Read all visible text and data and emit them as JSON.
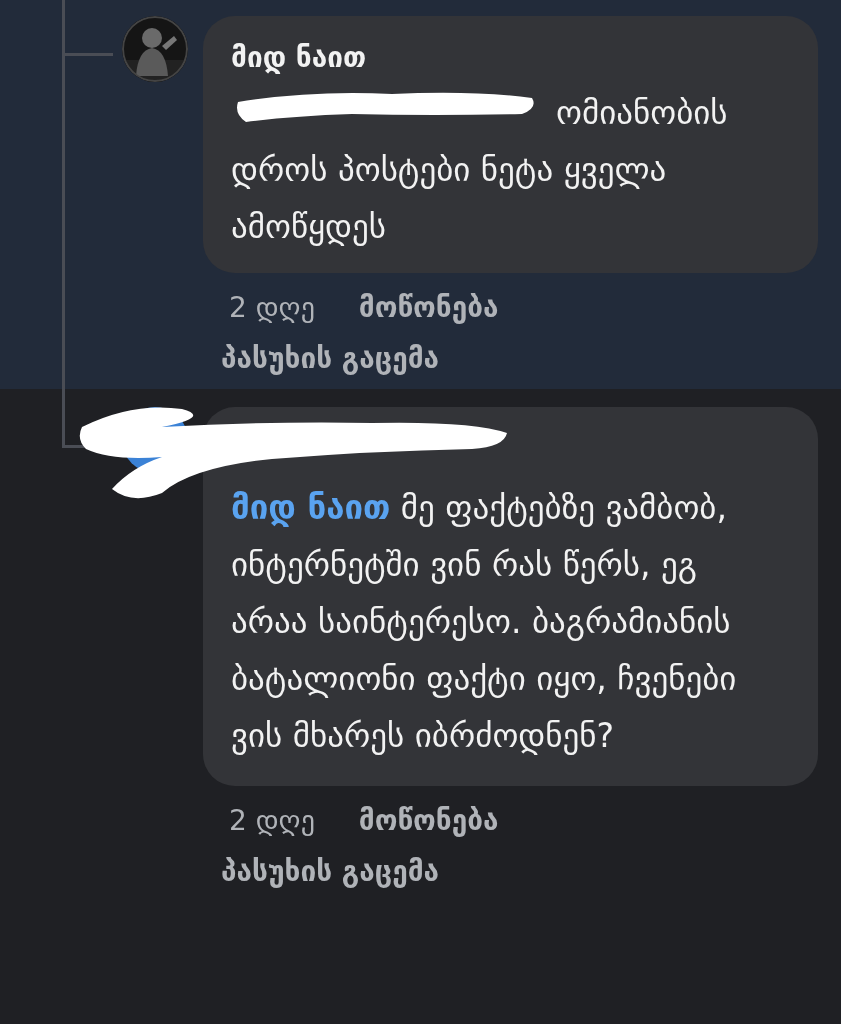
{
  "comments": [
    {
      "highlighted": true,
      "author": "მიდ ნაით",
      "author_redacted": false,
      "mention_redacted": true,
      "text": "ომიანობის დროს პოსტები ნეტა ყველა ამოწყდეს",
      "time": "2 დღე",
      "like": "მოწონება",
      "reply": "პასუხის გაცემა"
    },
    {
      "highlighted": false,
      "author_redacted": true,
      "avatar": {
        "kind": "plain"
      },
      "mention": "მიდ ნაით",
      "text": "მე ფაქტებზე ვამბობ, ინტერნეტში ვინ რას წერს, ეგ არაა საინტერესო. ბაგრამიანის ბატალიონი ფაქტი იყო, ჩვენები ვის მხარეს იბრძოდნენ?",
      "time": "2 დღე",
      "like": "მოწონება",
      "reply": "პასუხის გაცემა"
    }
  ]
}
